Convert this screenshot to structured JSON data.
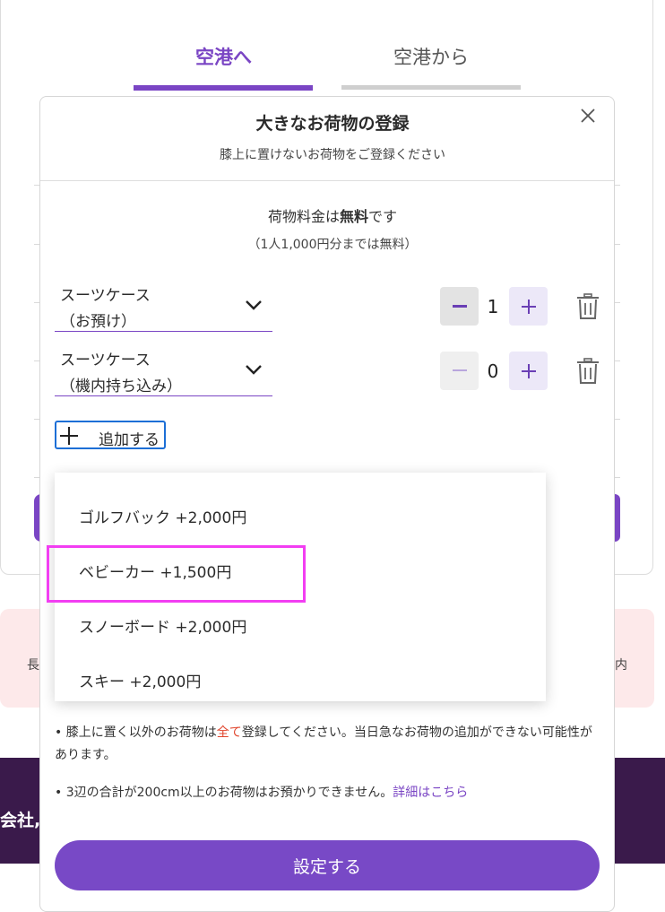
{
  "tabs": {
    "to_airport": "空港へ",
    "from_airport": "空港から"
  },
  "background": {
    "pink_left_text": "長",
    "pink_right_text": "内",
    "footer_text": "会社,"
  },
  "modal": {
    "title": "大きなお荷物の登録",
    "subtitle": "膝上に置けないお荷物をご登録ください",
    "fee_prefix": "荷物料金は",
    "fee_bold": "無料",
    "fee_suffix": "です",
    "fee_note": "（1人1,000円分までは無料）",
    "items": [
      {
        "line1": "スーツケース",
        "line2": "（お預け）",
        "quantity": "1"
      },
      {
        "line1": "スーツケース",
        "line2": "（機内持ち込み）",
        "quantity": "0"
      }
    ],
    "add_label": "追加する",
    "dropdown_options": [
      "ゴルフバック +2,000円",
      "ベビーカー +1,500円",
      "スノーボード +2,000円",
      "スキー +2,000円"
    ],
    "note1_a": "膝上に置く以外のお荷物は",
    "note1_red": "全て",
    "note1_b": "登録してください。当日急なお荷物の追加ができない可能性があります。",
    "note2_text": "3辺の合計が200cm以上のお荷物はお預かりできません。",
    "note2_link": "詳細はこちら",
    "submit_label": "設定する"
  },
  "colors": {
    "accent": "#7a45c4",
    "highlight": "#f23ef2",
    "warning": "#e0452c"
  }
}
